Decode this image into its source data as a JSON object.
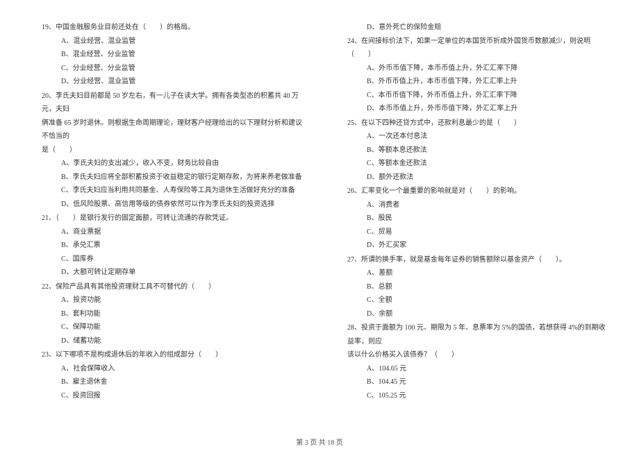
{
  "left": {
    "q19": {
      "text": "19、中国金融服务业目前还处在（　　）的格局。",
      "a": "A、混业经营、混业监管",
      "b": "B、混业经营、分业监管",
      "c": "C、分业经营、分业监管",
      "d": "D、分业经营、混业监管"
    },
    "q20": {
      "text1": "20、李氏夫妇目前都是 50 岁左右，有一儿子在读大学。拥有各类型态的积蓄共 40 万元，夫妇",
      "text2": "俩准备 65 岁时退休。则根据生命周期理论，理财客户经理给出的以下理财分析和建议不恰当的",
      "text3": "是（　　）",
      "a": "A、李氏夫妇的支出减少，收入不变，财务比较自由",
      "b": "B、李氏夫妇应将全部积蓄投资于收益稳定的银行定期存款，为将来养老做准备",
      "c": "C、李氏夫妇应当利用共同基金、人寿保险等工具为退休生活做好充分的准备",
      "d": "D、低风险股票、高信用等级的债券依然可以作为李氏夫妇的投资选择"
    },
    "q21": {
      "text": "21、（　　）是银行发行的固定面额，可转让流通的存款凭证。",
      "a": "A、商业票据",
      "b": "B、承兑汇票",
      "c": "C、国库券",
      "d": "D、大额可转让定期存单"
    },
    "q22": {
      "text": "22、保险产品具有其他投资理财工具不可替代的（　　）",
      "a": "A、投资功能",
      "b": "B、套利功能",
      "c": "C、保障功能",
      "d": "D、储蓄功能"
    },
    "q23": {
      "text": "23、以下哪项不是构成退休后的年收入的组成部分（　　）",
      "a": "A、社会保障收入",
      "b": "B、雇主退休金",
      "c": "C、投资回报"
    }
  },
  "right": {
    "q23d": "D、意外死亡的保险金赔",
    "q24": {
      "text": "24、在间接标价法下，如果一定单位的本国货币折成外国货币数额减少，则说明（　　）",
      "a": "A、外币币值下降，本币币值上升，外汇汇率下降",
      "b": "B、外币币值上升，本币币值下降，外汇汇率上升",
      "c": "C、本币币值下降，外币币值上升，外汇汇率下降",
      "d": "D、本币币值上升，外币币值下降，外汇汇率上升"
    },
    "q25": {
      "text": "25、在以下四种还贷方式中，还款利息最少的是（　　）",
      "a": "A、一次还本付息法",
      "b": "B、等额本息还款法",
      "c": "C、等额本金还款法",
      "d": "D、额外还款法"
    },
    "q26": {
      "text": "26、汇率变化一个最重要的影响就是对（　　）的影响。",
      "a": "A、消费者",
      "b": "B、股民",
      "c": "C、贸易",
      "d": "D、外汇买家"
    },
    "q27": {
      "text": "27、所谓的换手率，就是基金每年证券的销售额除以基金资产（　　）。",
      "a": "A、差额",
      "b": "B、总额",
      "c": "C、全额",
      "d": "D、余额"
    },
    "q28": {
      "text1": "28、投资于面额为 100 元、期限为 5 年、息票率为 5%的国债，若想获得 4%的到期收益率，则应",
      "text2": "该以什么价格买入该债券？（　　）",
      "a": "A、104.65 元",
      "b": "B、104.45 元",
      "c": "C、105.25 元"
    }
  },
  "footer": "第 3 页 共 18 页"
}
